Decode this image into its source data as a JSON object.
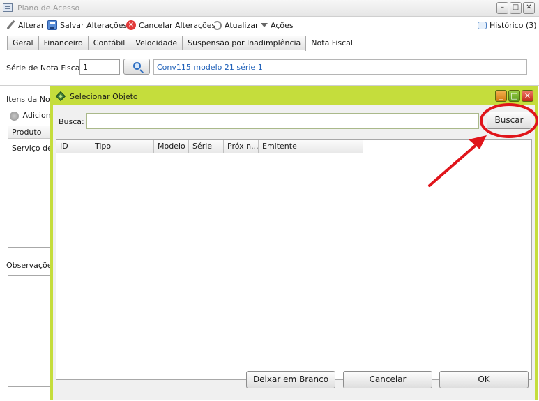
{
  "window": {
    "title": "Plano de Acesso"
  },
  "toolbar": {
    "alterar": "Alterar",
    "salvar": "Salvar Alterações",
    "cancelar": "Cancelar Alterações",
    "atualizar": "Atualizar",
    "acoes": "Ações",
    "historico": "Histórico (3)"
  },
  "tabs": [
    "Geral",
    "Financeiro",
    "Contábil",
    "Velocidade",
    "Suspensão por Inadimplência",
    "Nota Fiscal"
  ],
  "active_tab": "Nota Fiscal",
  "nota_fiscal": {
    "serie_label": "Série de Nota Fiscal:",
    "serie_value": "1",
    "serie_description": "Conv115 modelo 21 série 1",
    "itens_label": "Itens da Nota",
    "adicionar_label": "Adiciona",
    "produto_header": "Produto",
    "servico_cell": "Serviço de A",
    "observacoes_label": "Observações"
  },
  "dialog": {
    "title": "Selecionar Objeto",
    "busca_label": "Busca:",
    "busca_value": "",
    "buscar_button": "Buscar",
    "columns": [
      "ID",
      "Tipo",
      "Modelo",
      "Série",
      "Próx n...",
      "Emitente"
    ],
    "deixar_button": "Deixar em Branco",
    "cancelar_button": "Cancelar",
    "ok_button": "OK"
  },
  "colors": {
    "dialog_border": "#c5dd3c",
    "highlight": "#e0151b",
    "link_text": "#1d5fb8"
  }
}
